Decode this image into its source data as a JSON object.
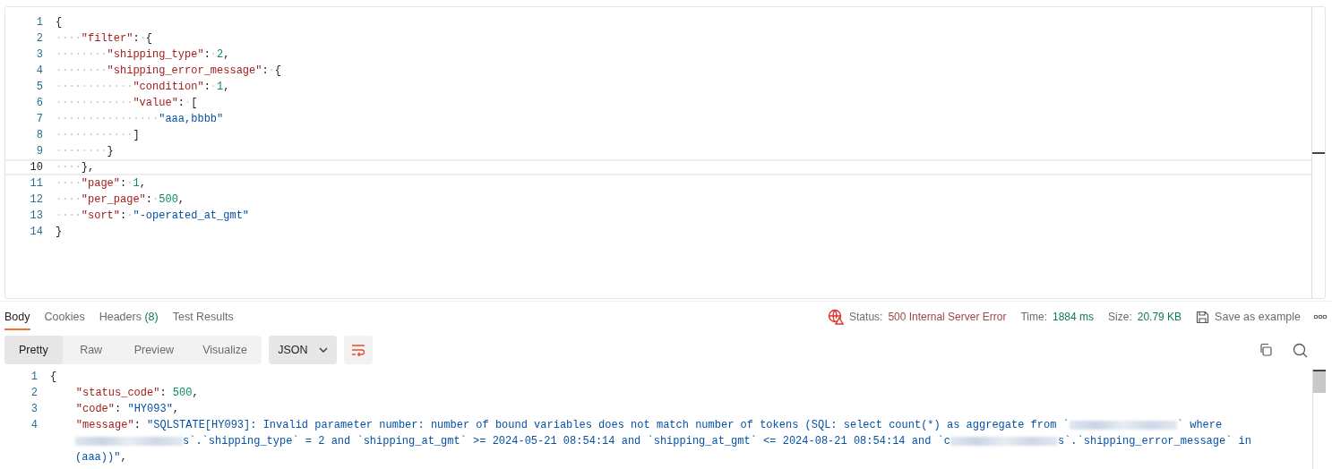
{
  "request_body": {
    "lines": [
      {
        "number": "1",
        "current": false,
        "tokens": [
          {
            "kind": "punct",
            "text": "{"
          }
        ]
      },
      {
        "number": "2",
        "current": false,
        "tokens": [
          {
            "kind": "ws",
            "text": "····"
          },
          {
            "kind": "key",
            "text": "\"filter\""
          },
          {
            "kind": "punct",
            "text": ":"
          },
          {
            "kind": "ws",
            "text": "·"
          },
          {
            "kind": "punct",
            "text": "{"
          }
        ]
      },
      {
        "number": "3",
        "current": false,
        "tokens": [
          {
            "kind": "ws",
            "text": "········"
          },
          {
            "kind": "key",
            "text": "\"shipping_type\""
          },
          {
            "kind": "punct",
            "text": ":"
          },
          {
            "kind": "ws",
            "text": "·"
          },
          {
            "kind": "num",
            "text": "2"
          },
          {
            "kind": "punct",
            "text": ","
          }
        ]
      },
      {
        "number": "4",
        "current": false,
        "tokens": [
          {
            "kind": "ws",
            "text": "········"
          },
          {
            "kind": "key",
            "text": "\"shipping_error_message\""
          },
          {
            "kind": "punct",
            "text": ":"
          },
          {
            "kind": "ws",
            "text": "·"
          },
          {
            "kind": "punct",
            "text": "{"
          }
        ]
      },
      {
        "number": "5",
        "current": false,
        "tokens": [
          {
            "kind": "ws",
            "text": "············"
          },
          {
            "kind": "key",
            "text": "\"condition\""
          },
          {
            "kind": "punct",
            "text": ":"
          },
          {
            "kind": "ws",
            "text": "·"
          },
          {
            "kind": "num",
            "text": "1"
          },
          {
            "kind": "punct",
            "text": ","
          }
        ]
      },
      {
        "number": "6",
        "current": false,
        "tokens": [
          {
            "kind": "ws",
            "text": "············"
          },
          {
            "kind": "key",
            "text": "\"value\""
          },
          {
            "kind": "punct",
            "text": ":"
          },
          {
            "kind": "ws",
            "text": "·"
          },
          {
            "kind": "punct",
            "text": "["
          }
        ]
      },
      {
        "number": "7",
        "current": false,
        "tokens": [
          {
            "kind": "ws",
            "text": "················"
          },
          {
            "kind": "str",
            "text": "\"aaa,bbbb\""
          }
        ]
      },
      {
        "number": "8",
        "current": false,
        "tokens": [
          {
            "kind": "ws",
            "text": "············"
          },
          {
            "kind": "punct",
            "text": "]"
          }
        ]
      },
      {
        "number": "9",
        "current": false,
        "tokens": [
          {
            "kind": "ws",
            "text": "········"
          },
          {
            "kind": "punct",
            "text": "}"
          }
        ]
      },
      {
        "number": "10",
        "current": true,
        "tokens": [
          {
            "kind": "ws",
            "text": "····"
          },
          {
            "kind": "punct",
            "text": "},"
          }
        ]
      },
      {
        "number": "11",
        "current": false,
        "tokens": [
          {
            "kind": "ws",
            "text": "····"
          },
          {
            "kind": "key",
            "text": "\"page\""
          },
          {
            "kind": "punct",
            "text": ":"
          },
          {
            "kind": "ws",
            "text": "·"
          },
          {
            "kind": "num",
            "text": "1"
          },
          {
            "kind": "punct",
            "text": ","
          }
        ]
      },
      {
        "number": "12",
        "current": false,
        "tokens": [
          {
            "kind": "ws",
            "text": "····"
          },
          {
            "kind": "key",
            "text": "\"per_page\""
          },
          {
            "kind": "punct",
            "text": ":"
          },
          {
            "kind": "ws",
            "text": "·"
          },
          {
            "kind": "num",
            "text": "500"
          },
          {
            "kind": "punct",
            "text": ","
          }
        ]
      },
      {
        "number": "13",
        "current": false,
        "tokens": [
          {
            "kind": "ws",
            "text": "····"
          },
          {
            "kind": "key",
            "text": "\"sort\""
          },
          {
            "kind": "punct",
            "text": ":"
          },
          {
            "kind": "ws",
            "text": "·"
          },
          {
            "kind": "str",
            "text": "\"-operated_at_gmt\""
          }
        ]
      },
      {
        "number": "14",
        "current": false,
        "tokens": [
          {
            "kind": "punct",
            "text": "}"
          }
        ]
      }
    ]
  },
  "response_tabs": [
    {
      "label": "Body",
      "selected": true
    },
    {
      "label": "Cookies",
      "selected": false
    },
    {
      "label": "Headers",
      "count": "(8)",
      "selected": false
    },
    {
      "label": "Test Results",
      "selected": false
    }
  ],
  "response_meta": {
    "status_label": "Status:",
    "status": "500 Internal Server Error",
    "time_label": "Time:",
    "time": "1884 ms",
    "size_label": "Size:",
    "size": "20.79 KB",
    "save": "Save as example"
  },
  "view_modes": [
    {
      "label": "Pretty",
      "selected": true
    },
    {
      "label": "Raw",
      "selected": false
    },
    {
      "label": "Preview",
      "selected": false
    },
    {
      "label": "Visualize",
      "selected": false
    }
  ],
  "format": {
    "value": "JSON"
  },
  "response_body": {
    "lines": [
      {
        "number": "1",
        "tokens": [
          {
            "kind": "punct",
            "text": "{"
          }
        ]
      },
      {
        "number": "2",
        "tokens": [
          {
            "kind": "indent"
          },
          {
            "kind": "key",
            "text": "\"status_code\""
          },
          {
            "kind": "punct",
            "text": ": "
          },
          {
            "kind": "num",
            "text": "500"
          },
          {
            "kind": "punct",
            "text": ","
          }
        ]
      },
      {
        "number": "3",
        "tokens": [
          {
            "kind": "indent"
          },
          {
            "kind": "key",
            "text": "\"code\""
          },
          {
            "kind": "punct",
            "text": ": "
          },
          {
            "kind": "str",
            "text": "\"HY093\""
          },
          {
            "kind": "punct",
            "text": ","
          }
        ]
      },
      {
        "number": "4",
        "tokens": [
          {
            "kind": "indent"
          },
          {
            "kind": "key",
            "text": "\"message\""
          },
          {
            "kind": "punct",
            "text": ": "
          },
          {
            "kind": "str",
            "text": "\"SQLSTATE[HY093]: Invalid parameter number: number of bound variables does not match number of tokens (SQL: select count(*) as aggregate from `"
          },
          {
            "kind": "redacted"
          },
          {
            "kind": "str",
            "text": "` where"
          }
        ]
      },
      {
        "tokens": [
          {
            "kind": "redacted"
          },
          {
            "kind": "str",
            "text": "s`.`shipping_type` = 2 and `shipping_at_gmt` >= 2024-05-21 08:54:14 and `shipping_at_gmt` <= 2024-08-21 08:54:14 and `c"
          },
          {
            "kind": "redacted"
          },
          {
            "kind": "str",
            "text": "s`.`shipping_error_message` in"
          }
        ]
      },
      {
        "tokens": [
          {
            "kind": "str",
            "text": "(aaa))\""
          },
          {
            "kind": "punct",
            "text": ","
          }
        ]
      }
    ]
  }
}
